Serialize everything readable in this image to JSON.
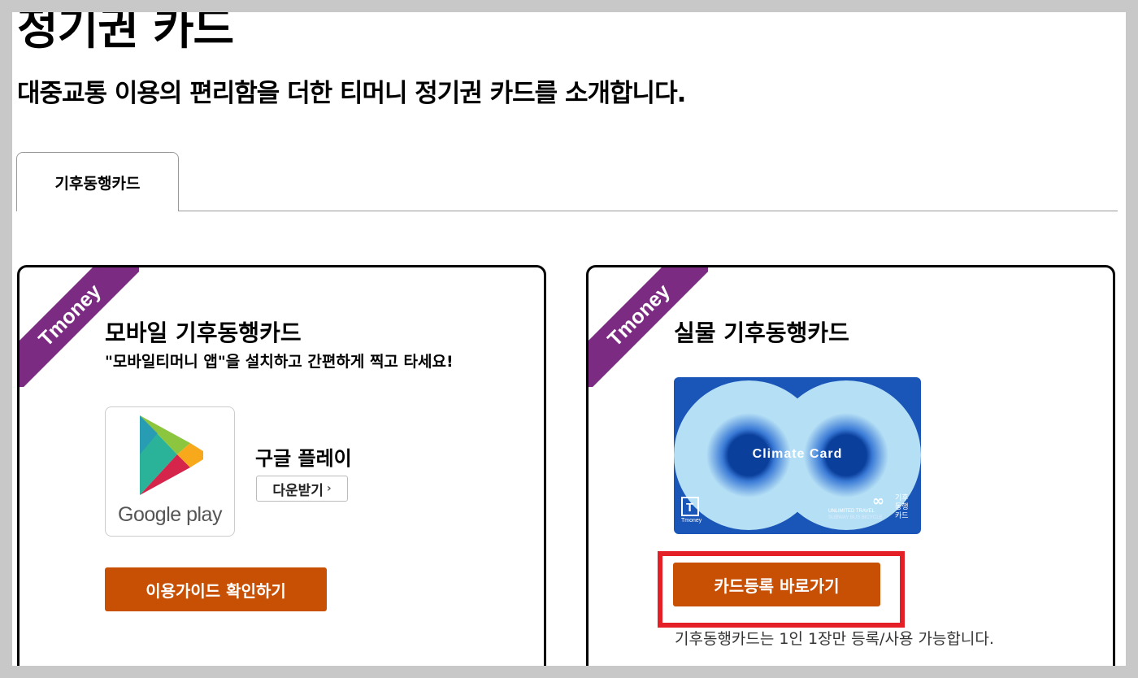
{
  "page": {
    "title": "정기권 카드",
    "subtitle": "대중교통 이용의 편리함을 더한 티머니 정기권 카드를 소개합니다."
  },
  "tabs": [
    {
      "label": "기후동행카드",
      "active": true
    }
  ],
  "cards": {
    "mobile": {
      "ribbon": "Tmoney",
      "title": "모바일 기후동행카드",
      "subtitle": "\"모바일티머니 앱\"을 설치하고 간편하게 찍고 타세요!",
      "store_logo_text": "Google play",
      "store_label": "구글 플레이",
      "download_label": "다운받기",
      "guide_button": "이용가이드 확인하기"
    },
    "physical": {
      "ribbon": "Tmoney",
      "title": "실물 기후동행카드",
      "card_image": {
        "name": "Climate Card",
        "corner_text": "기후 동행 카드",
        "small_text_1": "UNLIMITED TRAVEL",
        "small_text_2": "SUBWAY BUS BICYCLE",
        "brand": "Tmoney"
      },
      "register_button": "카드등록 바로가기",
      "note": "기후동행카드는 1인 1장만 등록/사용 가능합니다."
    }
  },
  "colors": {
    "ribbon": "#7b2c82",
    "button": "#c85005",
    "highlight": "#e41f26",
    "card_bg": "#b5dff5",
    "card_blue": "#0a3f9c"
  }
}
